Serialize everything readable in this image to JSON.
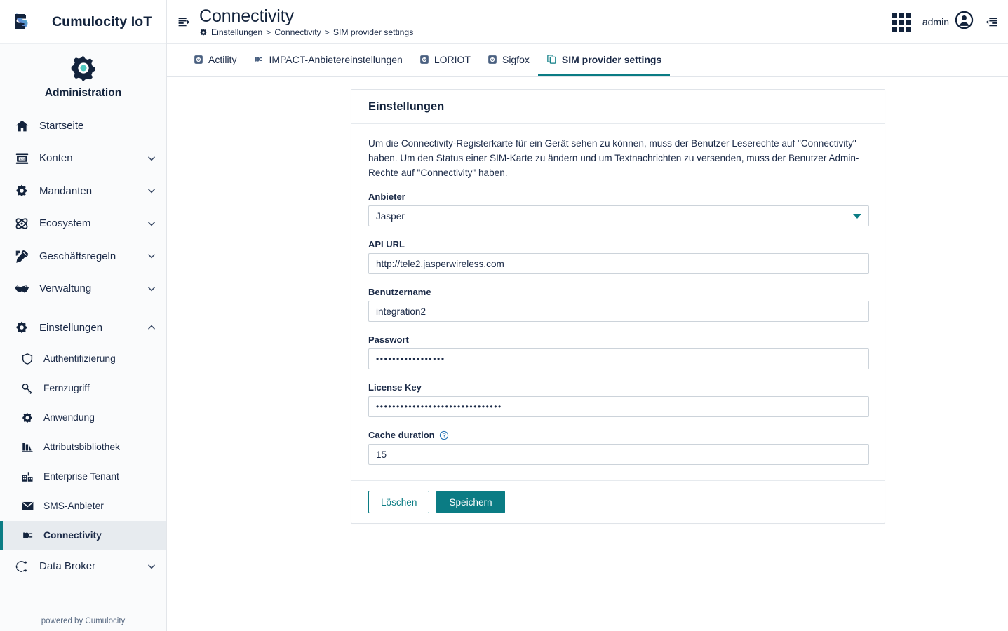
{
  "brand": {
    "name": "Cumulocity IoT",
    "app_title": "Administration",
    "logo_icon": "cumulocity-logo",
    "app_icon": "gear-icon",
    "footer": "powered by Cumulocity"
  },
  "sidebar": {
    "items": [
      {
        "label": "Startseite",
        "icon": "home-icon",
        "expandable": false
      },
      {
        "label": "Konten",
        "icon": "accounts-icon",
        "expandable": true,
        "chevron": "chevron-down-icon"
      },
      {
        "label": "Mandanten",
        "icon": "gear-icon",
        "expandable": true,
        "chevron": "chevron-down-icon"
      },
      {
        "label": "Ecosystem",
        "icon": "atom-icon",
        "expandable": true,
        "chevron": "chevron-down-icon"
      },
      {
        "label": "Geschäftsregeln",
        "icon": "ruler-pencil-icon",
        "expandable": true,
        "chevron": "chevron-down-icon"
      },
      {
        "label": "Verwaltung",
        "icon": "handshake-icon",
        "expandable": true,
        "chevron": "chevron-down-icon"
      }
    ],
    "settings_group": {
      "label": "Einstellungen",
      "icon": "gear-icon",
      "chevron": "chevron-up-icon",
      "expanded": true,
      "children": [
        {
          "label": "Authentifizierung",
          "icon": "shield-icon",
          "active": false
        },
        {
          "label": "Fernzugriff",
          "icon": "key-icon",
          "active": false
        },
        {
          "label": "Anwendung",
          "icon": "gear-icon",
          "active": false
        },
        {
          "label": "Attributsbibliothek",
          "icon": "library-icon",
          "active": false
        },
        {
          "label": "Enterprise Tenant",
          "icon": "building-icon",
          "active": false
        },
        {
          "label": "SMS-Anbieter",
          "icon": "envelope-icon",
          "active": false
        },
        {
          "label": "Connectivity",
          "icon": "plug-icon",
          "active": true
        }
      ]
    },
    "data_broker": {
      "label": "Data Broker",
      "icon": "broker-icon",
      "chevron": "chevron-down-icon"
    }
  },
  "topbar": {
    "collapse_icon": "collapse-sidebar-icon",
    "title": "Connectivity",
    "breadcrumb": {
      "icon": "gear-icon",
      "items": [
        "Einstellungen",
        "Connectivity",
        "SIM provider settings"
      ],
      "separator": ">"
    },
    "apps_icon": "app-grid-icon",
    "user_name": "admin",
    "user_icon": "user-avatar-icon",
    "right_drawer_icon": "right-drawer-icon"
  },
  "tabs": [
    {
      "label": "Actility",
      "icon": "socket-icon",
      "active": false
    },
    {
      "label": "IMPACT-Anbietereinstellungen",
      "icon": "plug-icon",
      "active": false
    },
    {
      "label": "LORIOT",
      "icon": "socket-icon",
      "active": false
    },
    {
      "label": "Sigfox",
      "icon": "socket-icon",
      "active": false
    },
    {
      "label": "SIM provider settings",
      "icon": "copy-icon",
      "active": true
    }
  ],
  "card": {
    "title": "Einstellungen",
    "intro": "Um die Connectivity-Registerkarte für ein Gerät sehen zu können, muss der Benutzer Leserechte auf \"Connectivity\" haben. Um den Status einer SIM-Karte zu ändern und um Textnachrichten zu versenden, muss der Benutzer Admin-Rechte auf \"Connectivity\" haben.",
    "fields": {
      "provider": {
        "label": "Anbieter",
        "value": "Jasper",
        "options": [
          "Jasper"
        ],
        "caret_icon": "chevron-down-icon"
      },
      "api_url": {
        "label": "API URL",
        "value": "http://tele2.jasperwireless.com",
        "placeholder": ""
      },
      "username": {
        "label": "Benutzername",
        "value": "integration2",
        "placeholder": ""
      },
      "password": {
        "label": "Passwort",
        "value": "•••••••••••••••••",
        "masked": true,
        "placeholder": ""
      },
      "license_key": {
        "label": "License Key",
        "value": "•••••••••••••••••••••••••••••••",
        "masked": true,
        "placeholder": ""
      },
      "cache_duration": {
        "label": "Cache duration",
        "value": "15",
        "placeholder": "",
        "help_icon": "help-circle-icon"
      }
    },
    "buttons": {
      "delete_label": "Löschen",
      "save_label": "Speichern"
    }
  },
  "colors": {
    "accent_teal": "#0b7c84",
    "navy": "#13233c",
    "sidebar_bg": "#fafbfc",
    "active_item_bg": "#e7ebef",
    "help_blue": "#1f6fb2"
  }
}
